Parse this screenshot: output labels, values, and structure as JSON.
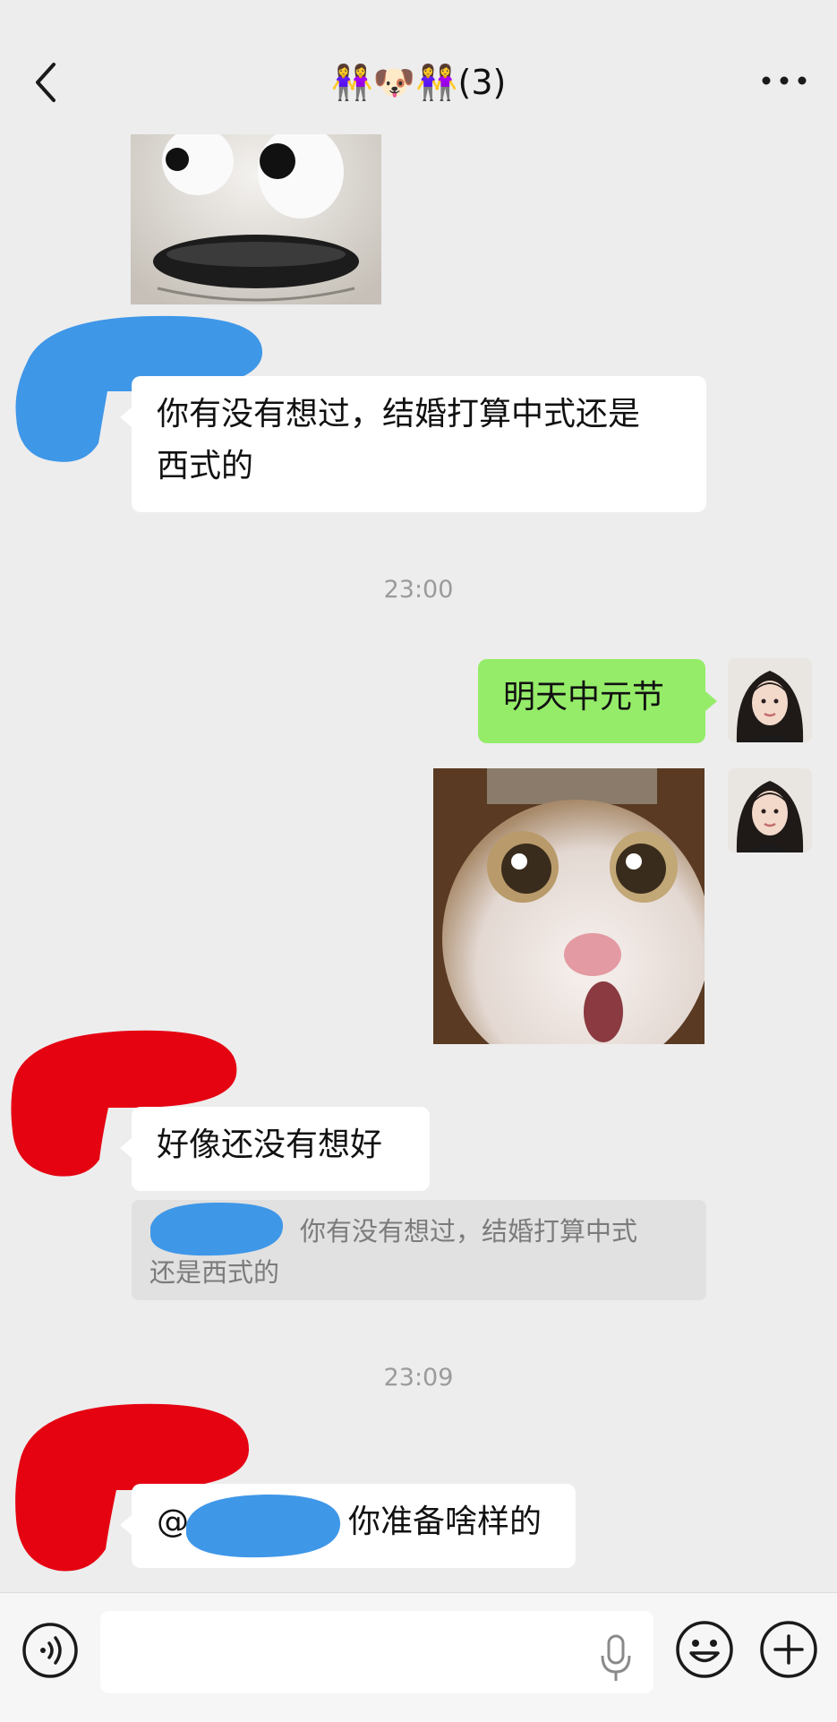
{
  "header": {
    "title": "👭🐶👭(3)",
    "back_icon": "chevron-left-icon",
    "more_icon": "more-dots-icon"
  },
  "messages": {
    "m1_text_line1": "你有没有想过，结婚打算中式还是",
    "m1_text_line2": "西式的",
    "time1": "23:00",
    "m2_text": "明天中元节",
    "m3_text": "好像还没有想好",
    "quote_line1": "你有没有想过，结婚打算中式",
    "quote_line2": "还是西式的",
    "time2": "23:09",
    "m4_at": "@",
    "m4_text": "你准备啥样的"
  },
  "stickers": {
    "dog": "white-dog-face-sticker",
    "cat": "surprised-cat-sticker"
  },
  "input_bar": {
    "voice_icon": "voice-mode-icon",
    "mic_icon": "microphone-icon",
    "emoji_icon": "emoji-icon",
    "plus_icon": "plus-icon",
    "value": ""
  },
  "colors": {
    "background": "#ededed",
    "self_bubble": "#95ec69",
    "other_bubble": "#ffffff",
    "redact_blue": "#3f97e8",
    "redact_red": "#e50312"
  }
}
